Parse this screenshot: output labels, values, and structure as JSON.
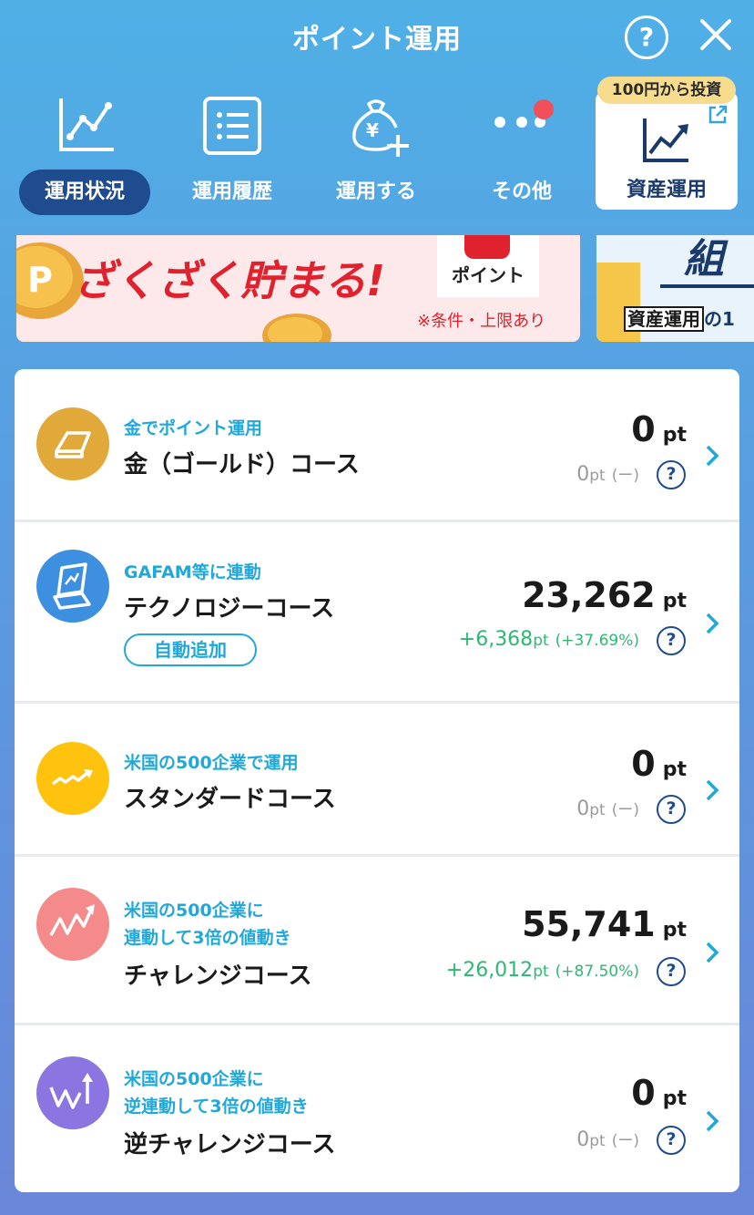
{
  "header": {
    "title": "ポイント運用",
    "help_label": "?"
  },
  "nav": {
    "items": [
      {
        "label": "運用状況",
        "icon": "line-chart-icon",
        "active": true
      },
      {
        "label": "運用履歴",
        "icon": "list-icon",
        "active": false
      },
      {
        "label": "運用する",
        "icon": "yen-bag-plus-icon",
        "active": false
      },
      {
        "label": "その他",
        "icon": "more-dots-icon",
        "active": false
      }
    ],
    "asset": {
      "badge": "100円から投資",
      "label": "資産運用",
      "icon": "trend-chart-icon"
    }
  },
  "banners": [
    {
      "headline": "ざくざく貯まる!",
      "logo_text": "ポイント",
      "note": "※条件・上限あり"
    },
    {
      "text_a": "組",
      "text_b": "資産運用",
      "text_c": "の1"
    }
  ],
  "courses": [
    {
      "subtitle": "金でポイント運用",
      "name": "金（ゴールド）コース",
      "points": "0",
      "unit": "pt",
      "delta_pt": "0",
      "delta_unit": "pt",
      "delta_pct": "(ー)",
      "icon": "gold-bar-icon",
      "color": "#e0a93a"
    },
    {
      "subtitle": "GAFAM等に連動",
      "name": "テクノロジーコース",
      "auto_label": "自動追加",
      "points": "23,262",
      "unit": "pt",
      "delta_pt": "+6,368",
      "delta_unit": "pt",
      "delta_pct": "(+37.69%)",
      "icon": "laptop-icon",
      "color": "#3d8fe0"
    },
    {
      "subtitle": "米国の500企業で運用",
      "name": "スタンダードコース",
      "points": "0",
      "unit": "pt",
      "delta_pt": "0",
      "delta_unit": "pt",
      "delta_pct": "(ー)",
      "icon": "wave-arrow-icon",
      "color": "#ffc20e"
    },
    {
      "subtitle": "米国の500企業に",
      "subtitle2": "連動して3倍の値動き",
      "name": "チャレンジコース",
      "points": "55,741",
      "unit": "pt",
      "delta_pt": "+26,012",
      "delta_unit": "pt",
      "delta_pct": "(+87.50%)",
      "icon": "zigzag-up-icon",
      "color": "#f48a8a"
    },
    {
      "subtitle": "米国の500企業に",
      "subtitle2": "逆連動して3倍の値動き",
      "name": "逆チャレンジコース",
      "points": "0",
      "unit": "pt",
      "delta_pt": "0",
      "delta_unit": "pt",
      "delta_pct": "(ー)",
      "icon": "zigzag-inverse-icon",
      "color": "#8b75e0"
    }
  ],
  "qmark": "?"
}
